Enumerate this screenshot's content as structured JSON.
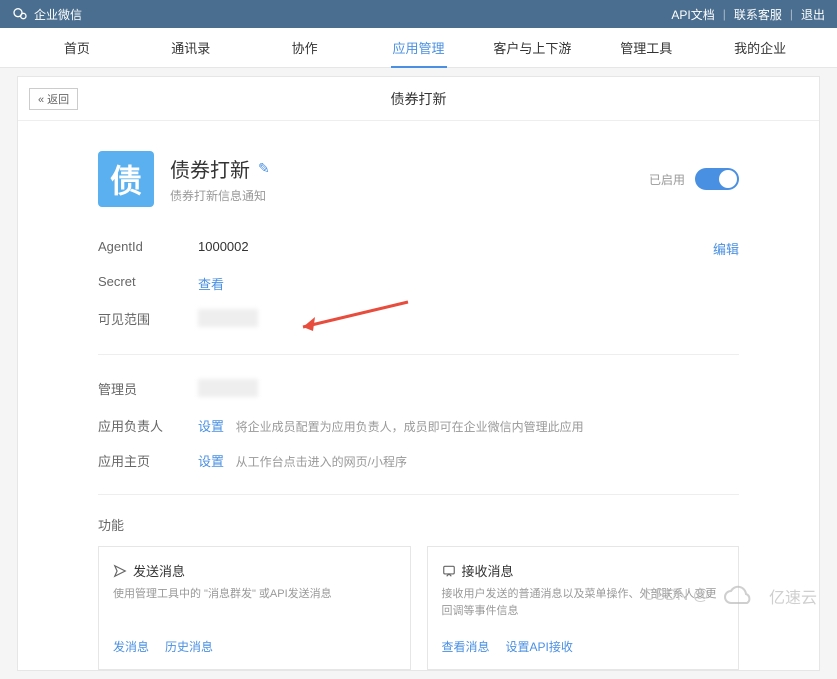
{
  "topbar": {
    "brand": "企业微信",
    "links": {
      "api": "API文档",
      "contact": "联系客服",
      "logout": "退出"
    }
  },
  "nav": [
    "首页",
    "通讯录",
    "协作",
    "应用管理",
    "客户与上下游",
    "管理工具",
    "我的企业"
  ],
  "back_btn": "« 返回",
  "page_title": "债券打新",
  "app": {
    "icon_char": "债",
    "name": "债券打新",
    "desc": "债券打新信息通知",
    "enabled_label": "已启用"
  },
  "fields": {
    "agent_id_label": "AgentId",
    "agent_id_value": "1000002",
    "edit": "编辑",
    "secret_label": "Secret",
    "secret_action": "查看",
    "scope_label": "可见范围",
    "admin_label": "管理员",
    "owner_label": "应用负责人",
    "owner_action": "设置",
    "owner_hint": "将企业成员配置为应用负责人，成员即可在企业微信内管理此应用",
    "home_label": "应用主页",
    "home_action": "设置",
    "home_hint": "从工作台点击进入的网页/小程序"
  },
  "func_title": "功能",
  "cards": {
    "send": {
      "title": "发送消息",
      "desc": "使用管理工具中的 \"消息群发\" 或API发送消息",
      "a1": "发消息",
      "a2": "历史消息"
    },
    "recv": {
      "title": "接收消息",
      "desc": "接收用户发送的普通消息以及菜单操作、外部联系人变更回调等事件信息",
      "a1": "查看消息",
      "a2": "设置API接收"
    }
  },
  "watermark": {
    "csdn": "CSDN @",
    "yisu": "亿速云"
  }
}
